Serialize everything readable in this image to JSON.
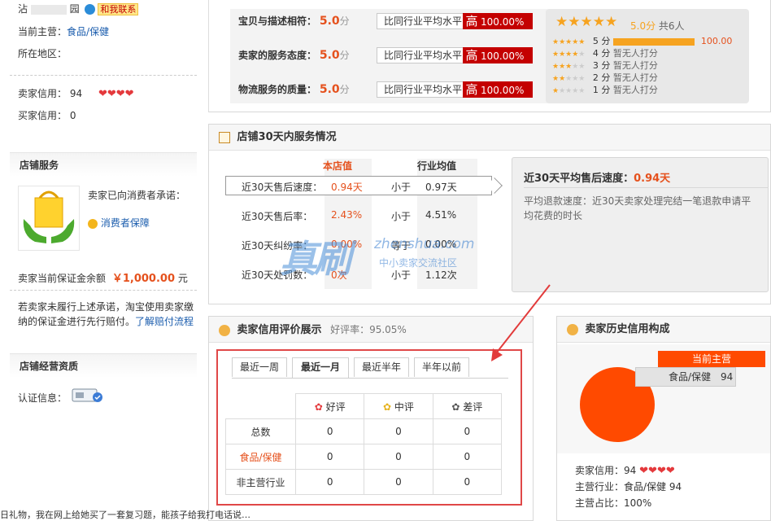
{
  "sidebar": {
    "shop_name_prefix": "沾",
    "shop_name_suffix": "园",
    "contact_label": "和我联系",
    "main_business_label": "当前主营：",
    "main_business_value": "食品/保健",
    "region_label": "所在地区：",
    "seller_credit_label": "卖家信用：",
    "seller_credit_value": "94",
    "buyer_credit_label": "买家信用：",
    "buyer_credit_value": "0",
    "shop_service_title": "店铺服务",
    "promise_text": "卖家已向消费者承诺：",
    "guarantee_link": "消费者保障",
    "deposit_label": "卖家当前保证金余额",
    "deposit_value": "￥1,000.00",
    "deposit_unit": "元",
    "deposit_note": "若卖家未履行上述承诺，淘宝使用卖家缴纳的保证金进行先行赔付。",
    "deposit_link": "了解赔付流程",
    "qualification_title": "店铺经营资质",
    "cert_label": "认证信息："
  },
  "dsr": {
    "rows": [
      {
        "label": "宝贝与描述相符：",
        "score": "5.0",
        "unit": "分",
        "cmp": "比同行业平均水平",
        "level": "高",
        "pct": "100.00%"
      },
      {
        "label": "卖家的服务态度：",
        "score": "5.0",
        "unit": "分",
        "cmp": "比同行业平均水平",
        "level": "高",
        "pct": "100.00%"
      },
      {
        "label": "物流服务的质量：",
        "score": "5.0",
        "unit": "分",
        "cmp": "比同行业平均水平",
        "level": "高",
        "pct": "100.00%"
      }
    ],
    "summary_score": "5.0分",
    "summary_count": "共6人",
    "distribution": [
      {
        "stars": 5,
        "label": "5 分",
        "value": "100.00",
        "fill": 1.0
      },
      {
        "stars": 4,
        "label": "4 分",
        "value": "暂无人打分",
        "fill": 0
      },
      {
        "stars": 3,
        "label": "3 分",
        "value": "暂无人打分",
        "fill": 0
      },
      {
        "stars": 2,
        "label": "2 分",
        "value": "暂无人打分",
        "fill": 0
      },
      {
        "stars": 1,
        "label": "1 分",
        "value": "暂无人打分",
        "fill": 0
      }
    ]
  },
  "service30": {
    "title": "店铺30天内服务情况",
    "col_shop": "本店值",
    "col_industry": "行业均值",
    "rows": [
      {
        "label": "近30天售后速度：",
        "shop": "0.94天",
        "cmp": "小于",
        "industry": "0.97天"
      },
      {
        "label": "近30天售后率：",
        "shop": "2.43%",
        "cmp": "小于",
        "industry": "4.51%"
      },
      {
        "label": "近30天纠纷率：",
        "shop": "0.00%",
        "cmp": "等于",
        "industry": "0.00%"
      },
      {
        "label": "近30天处罚数：",
        "shop": "0次",
        "cmp": "小于",
        "industry": "1.12次"
      }
    ],
    "detail_title_prefix": "近30天平均售后速度：",
    "detail_title_value": "0.94天",
    "detail_text": "平均退款速度：近30天卖家处理完结一笔退款申请平均花费的时长"
  },
  "watermark": {
    "big": "真刷",
    "url": "zhenshua.com",
    "sub": "中小卖家交流社区"
  },
  "credit": {
    "title": "卖家信用评价展示",
    "good_rate": "好评率：95.05%",
    "tabs": [
      "最近一周",
      "最近一月",
      "最近半年",
      "半年以前"
    ],
    "active_tab": 1,
    "headers": [
      "好评",
      "中评",
      "差评"
    ],
    "rows": [
      {
        "label": "总数",
        "values": [
          "0",
          "0",
          "0"
        ],
        "highlight": false
      },
      {
        "label": "食品/保健",
        "values": [
          "0",
          "0",
          "0"
        ],
        "highlight": true
      },
      {
        "label": "非主营行业",
        "values": [
          "0",
          "0",
          "0"
        ],
        "highlight": false
      }
    ]
  },
  "history": {
    "title": "卖家历史信用构成",
    "main_label": "当前主营",
    "main_category": "食品/保健",
    "main_value": "94",
    "credit_label": "卖家信用：",
    "credit_value": "94",
    "main_biz_label": "主营行业：",
    "main_biz_value": "食品/保健 94",
    "share_label": "主营占比：",
    "share_value": "100%"
  },
  "footer_text": "日礼物，我在网上给她买了一套复习题，能孩子给我打电话说…",
  "colors": {
    "orange": "#e5511d",
    "red": "#c40000",
    "pie": "#ff4a00",
    "arrow": "#e23b3b"
  }
}
